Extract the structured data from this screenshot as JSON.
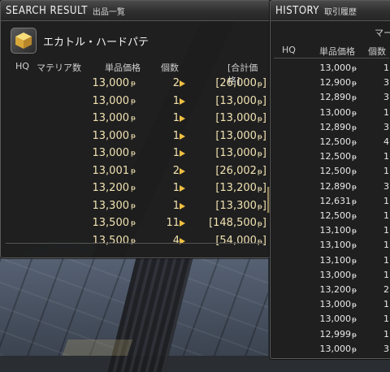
{
  "search": {
    "title": "SEARCH RESULT",
    "subtitle": "出品一覧",
    "item_name": "エカトル・ハードパテ",
    "headers": {
      "hq": "HQ",
      "materia": "マテリア数",
      "price": "単品価格",
      "qty": "個数",
      "total": "[合計価格]"
    },
    "rows": [
      {
        "price": "13,000",
        "qty": "2",
        "total": "[26,000"
      },
      {
        "price": "13,000",
        "qty": "1",
        "total": "[13,000"
      },
      {
        "price": "13,000",
        "qty": "1",
        "total": "[13,000"
      },
      {
        "price": "13,000",
        "qty": "1",
        "total": "[13,000"
      },
      {
        "price": "13,000",
        "qty": "1",
        "total": "[13,000"
      },
      {
        "price": "13,001",
        "qty": "2",
        "total": "[26,002"
      },
      {
        "price": "13,200",
        "qty": "1",
        "total": "[13,200"
      },
      {
        "price": "13,300",
        "qty": "1",
        "total": "[13,300"
      },
      {
        "price": "13,500",
        "qty": "11",
        "total": "[148,500"
      },
      {
        "price": "13,500",
        "qty": "4",
        "total": "[54,000"
      }
    ]
  },
  "history": {
    "title": "HISTORY",
    "subtitle": "取引履歴",
    "market": "マー",
    "headers": {
      "hq": "HQ",
      "price": "単品価格",
      "qty": "個数"
    },
    "rows": [
      {
        "price": "13,000",
        "qty": "1"
      },
      {
        "price": "12,900",
        "qty": "3"
      },
      {
        "price": "12,890",
        "qty": "3"
      },
      {
        "price": "13,000",
        "qty": "1"
      },
      {
        "price": "12,890",
        "qty": "3"
      },
      {
        "price": "12,500",
        "qty": "4"
      },
      {
        "price": "12,500",
        "qty": "1"
      },
      {
        "price": "12,500",
        "qty": "1"
      },
      {
        "price": "12,890",
        "qty": "3"
      },
      {
        "price": "12,631",
        "qty": "1"
      },
      {
        "price": "12,500",
        "qty": "1"
      },
      {
        "price": "13,100",
        "qty": "1"
      },
      {
        "price": "13,100",
        "qty": "1"
      },
      {
        "price": "13,100",
        "qty": "1"
      },
      {
        "price": "13,000",
        "qty": "1"
      },
      {
        "price": "13,200",
        "qty": "2"
      },
      {
        "price": "13,000",
        "qty": "1"
      },
      {
        "price": "13,000",
        "qty": "1"
      },
      {
        "price": "12,999",
        "qty": "1"
      },
      {
        "price": "13,000",
        "qty": "3"
      }
    ]
  },
  "gil_symbol": "ᵽ",
  "colors": {
    "row_text": "#f0e2b0",
    "arrow": "#f0c040"
  }
}
